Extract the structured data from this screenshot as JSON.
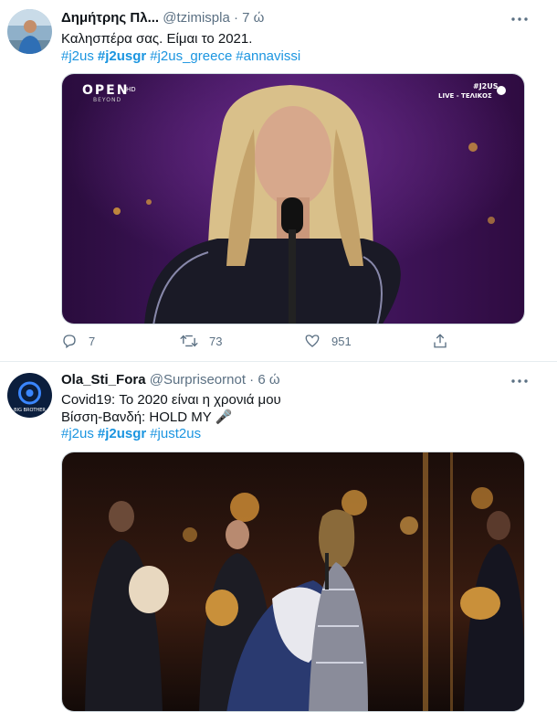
{
  "tweets": [
    {
      "name": "Δημήτρης Πλ...",
      "handle": "@tzimispla",
      "dot": "·",
      "time": "7 ώ",
      "text_lines": [
        "Καλησπέρα σας. Είμαι το 2021."
      ],
      "hashtags": [
        {
          "text": "#j2us",
          "bold": false
        },
        {
          "text": "#j2usgr",
          "bold": true
        },
        {
          "text": "#j2us_greece",
          "bold": false
        },
        {
          "text": "#annavissi",
          "bold": false
        }
      ],
      "media_overlay": {
        "logo_main": "OPEN",
        "logo_hd": "HD",
        "logo_sub": "BEYOND",
        "corner_tag": "#J2US",
        "corner_label": "LIVE - ΤΕΛΙΚΟΣ"
      },
      "stats": {
        "replies": "7",
        "retweets": "73",
        "likes": "951"
      }
    },
    {
      "name": "Ola_Sti_Fora",
      "handle": "@Surpriseornot",
      "dot": "·",
      "time": "6 ώ",
      "text_lines": [
        "Covid19: Το 2020 είναι η χρονιά μου",
        "Βίσση-Βανδή: HOLD MY 🎤"
      ],
      "hashtags": [
        {
          "text": "#j2us",
          "bold": false
        },
        {
          "text": "#j2usgr",
          "bold": true
        },
        {
          "text": "#just2us",
          "bold": false
        }
      ],
      "avatar_label": "BIG BROTHER"
    }
  ],
  "colors": {
    "link": "#1b95e0",
    "secondary": "#5b7083",
    "border": "#e6ecf0"
  },
  "icons": [
    "ellipsis-icon",
    "reply-icon",
    "retweet-icon",
    "like-icon",
    "share-icon"
  ]
}
